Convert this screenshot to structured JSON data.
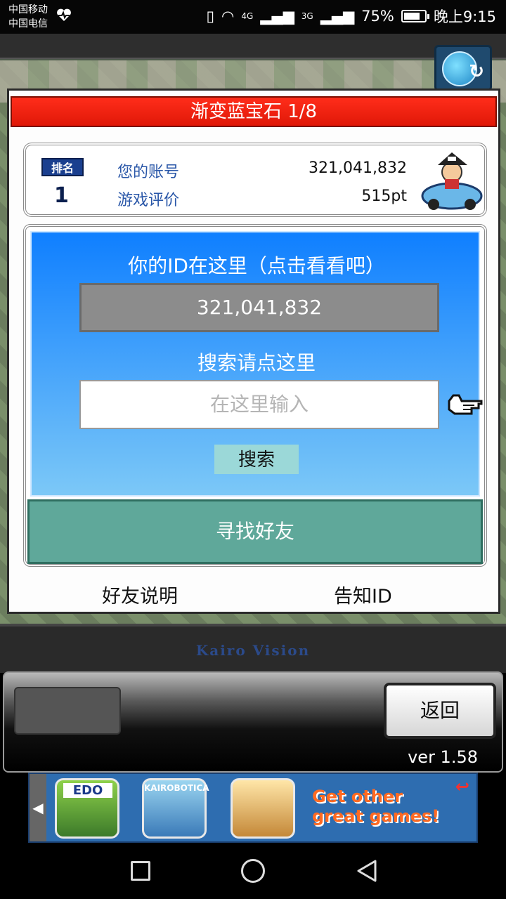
{
  "status_bar": {
    "carrier1": "中国移动",
    "carrier2": "中国电信",
    "network": "4G",
    "network2": "3G",
    "battery_pct": "75%",
    "time": "晚上9:15",
    "icons": [
      "heart-monitor-icon",
      "vibrate-icon",
      "wifi-icon",
      "signal-icon",
      "battery-icon"
    ]
  },
  "dialog": {
    "title": "渐变蓝宝石 1/8",
    "rank_label": "排名",
    "rank_number": "1",
    "account_label": "您的账号",
    "account_value": "321,041,832",
    "rating_label": "游戏评价",
    "rating_value": "515pt",
    "id_title": "你的ID在这里（点击看看吧）",
    "id_value": "321,041,832",
    "search_title": "搜索请点这里",
    "search_placeholder": "在这里输入",
    "search_button": "搜索",
    "find_friends_button": "寻找好友",
    "friend_help_link": "好友说明",
    "share_id_link": "告知ID"
  },
  "footer": {
    "logo": "Kairo Vision",
    "back_button": "返回",
    "version": "ver 1.58"
  },
  "ad": {
    "icons": [
      {
        "name": "edo-game-icon",
        "label": "EDO"
      },
      {
        "name": "kairobotica-game-icon",
        "label": "KAIROBOTICA"
      },
      {
        "name": "cafe-game-icon",
        "label": ""
      }
    ],
    "text_line1": "Get other",
    "text_line2": "great games!"
  },
  "colors": {
    "title_red": "#ff2d1a",
    "panel_blue": "#0f7fff",
    "find_green": "#5fa89a"
  }
}
